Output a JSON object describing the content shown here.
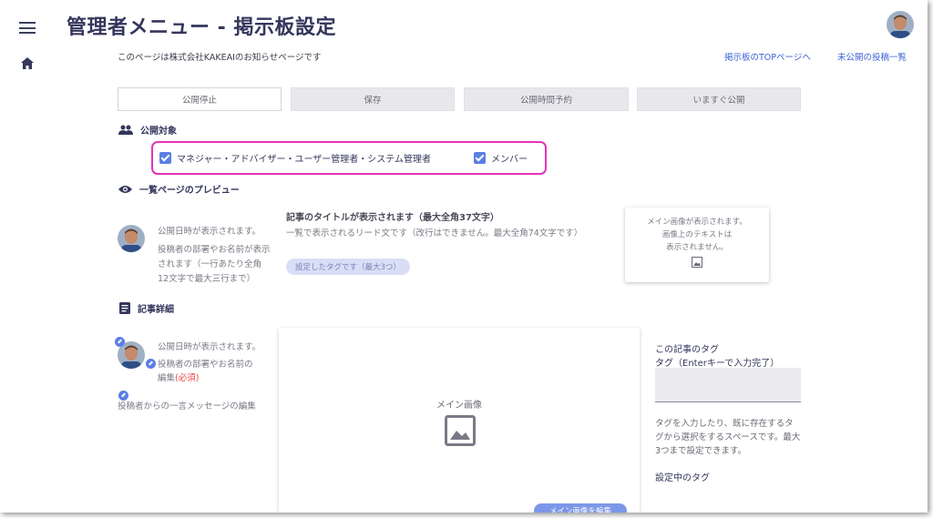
{
  "header": {
    "title": "管理者メニュー - 掲示板設定",
    "notice": "このページは株式会社KAKEAIのお知らせページです",
    "link_top": "掲示板のTOPページへ",
    "link_unpublished": "未公開の投稿一覧"
  },
  "actions": {
    "stop": "公開停止",
    "save": "保存",
    "schedule": "公開時間予約",
    "publish_now": "いますぐ公開"
  },
  "audience": {
    "section_title": "公開対象",
    "option_managers": "マネジャー・アドバイザー・ユーザー管理者・システム管理者",
    "option_members": "メンバー",
    "managers_checked": true,
    "members_checked": true
  },
  "preview": {
    "section_title": "一覧ページのプレビュー",
    "date_placeholder": "公開日時が表示されます。",
    "author_text": "投稿者の部署やお名前が表示されます（一行あたり全角12文字で最大三行まで）",
    "article_title": "記事のタイトルが表示されます（最大全角37文字）",
    "lead_text": "一覧で表示されるリード文です（改行はできません。最大全角74文字です）",
    "tag_pill": "設定したタグです（最大3つ）",
    "image_line1": "メイン画像が表示されます。",
    "image_line2": "画像上のテキストは",
    "image_line3": "表示されません。"
  },
  "detail": {
    "section_title": "記事詳細",
    "date_placeholder": "公開日時が表示されます。",
    "author_edit": "投稿者の部署やお名前の",
    "author_edit2": "編集",
    "required": "(必須)",
    "message_edit": "投稿者からの一言メッセージの編集",
    "main_image_label": "メイン画像",
    "edit_image_button": "メイン画像を編集",
    "tags_title": "この記事のタグ",
    "tags_input_label": "タグ（Enterキーで入力完了）",
    "tags_help": "タグを入力したり、既に存在するタグから選択をするスペースです。最大3つまで設定できます。",
    "tags_current": "設定中のタグ"
  },
  "colors": {
    "accent": "#5b7fe4",
    "title": "#34365c",
    "highlight": "#e434b8",
    "link": "#3f63d4"
  },
  "icons": [
    "menu-icon",
    "home-icon",
    "people-icon",
    "eye-icon",
    "article-icon",
    "image-icon",
    "pencil-icon"
  ]
}
